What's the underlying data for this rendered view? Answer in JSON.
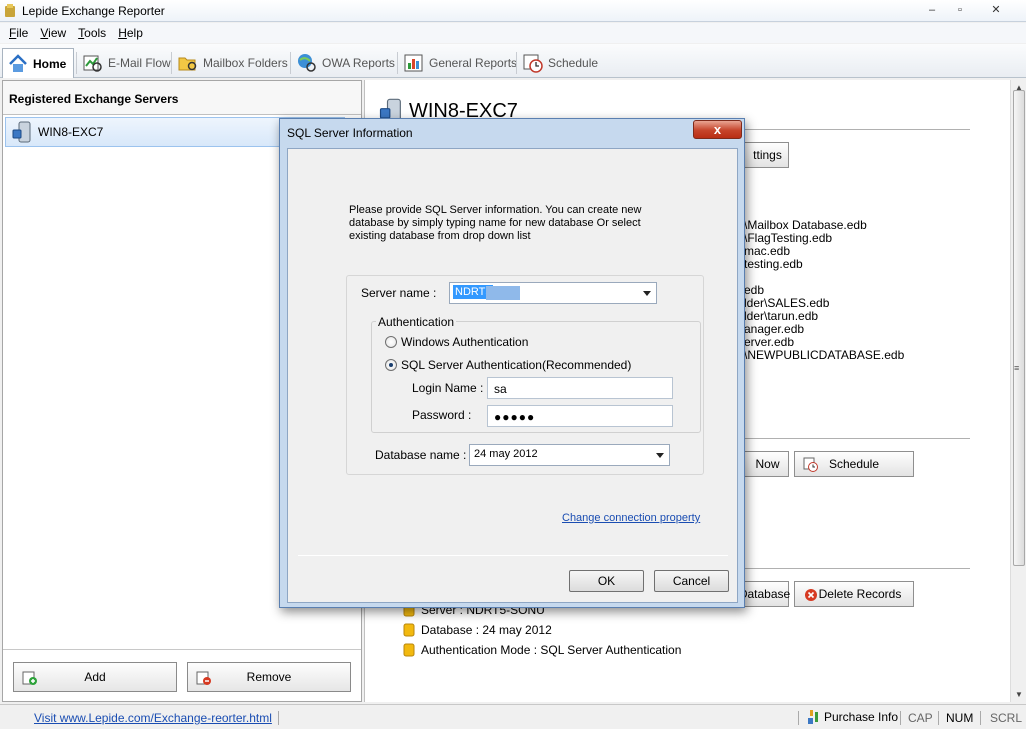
{
  "window": {
    "title": "Lepide Exchange Reporter",
    "min": "–",
    "max": "▫",
    "close": "✕"
  },
  "menu": [
    {
      "acc": "F",
      "rest": "ile"
    },
    {
      "acc": "V",
      "rest": "iew"
    },
    {
      "acc": "T",
      "rest": "ools"
    },
    {
      "acc": "H",
      "rest": "elp"
    }
  ],
  "tabs": [
    "Home",
    "E-Mail Flow",
    "Mailbox Folders",
    "OWA Reports",
    "General Reports",
    "Schedule"
  ],
  "left_panel": {
    "header": "Registered Exchange Servers",
    "server": "WIN8-EXC7",
    "add_label": "Add",
    "remove_label": "Remove"
  },
  "right_panel": {
    "server_title": "WIN8-EXC7",
    "settings_btn": "ttings",
    "db_lines": [
      "\\Mailbox Database.edb",
      "\\FlagTesting.edb",
      "mac.edb",
      "testing.edb",
      "edb",
      "lder\\SALES.edb",
      "lder\\tarun.edb",
      "anager.edb",
      "erver.edb",
      "\\NEWPUBLICDATABASE.edb"
    ],
    "now_btn": "Now",
    "schedule_btn": "Schedule",
    "database_btn": "Database",
    "delete_records_btn": "Delete Records",
    "info": [
      "Server : NDRT5-SONU",
      "Database : 24 may 2012",
      "Authentication Mode : SQL Server Authentication"
    ]
  },
  "dialog": {
    "title": "SQL Server Information",
    "close": "x",
    "description": "Please provide SQL Server information. You can create new database by simply typing name for new database Or select existing database from drop down list",
    "server_name_label": "Server name :",
    "server_name_value": "NDRT5",
    "auth_group_label": "Authentication",
    "windows_auth": "Windows Authentication",
    "sql_auth": "SQL Server Authentication(Recommended)",
    "login_label": "Login Name :",
    "login_value": "sa",
    "password_label": "Password :",
    "password_value": "●●●●●",
    "database_label": "Database name :",
    "database_value": "24 may 2012",
    "change_link": "Change connection property",
    "ok": "OK",
    "cancel": "Cancel"
  },
  "status": {
    "link": "Visit www.Lepide.com/Exchange-reorter.html",
    "purchase": "Purchase Info",
    "cap": "CAP",
    "num": "NUM",
    "scrl": "SCRL"
  }
}
